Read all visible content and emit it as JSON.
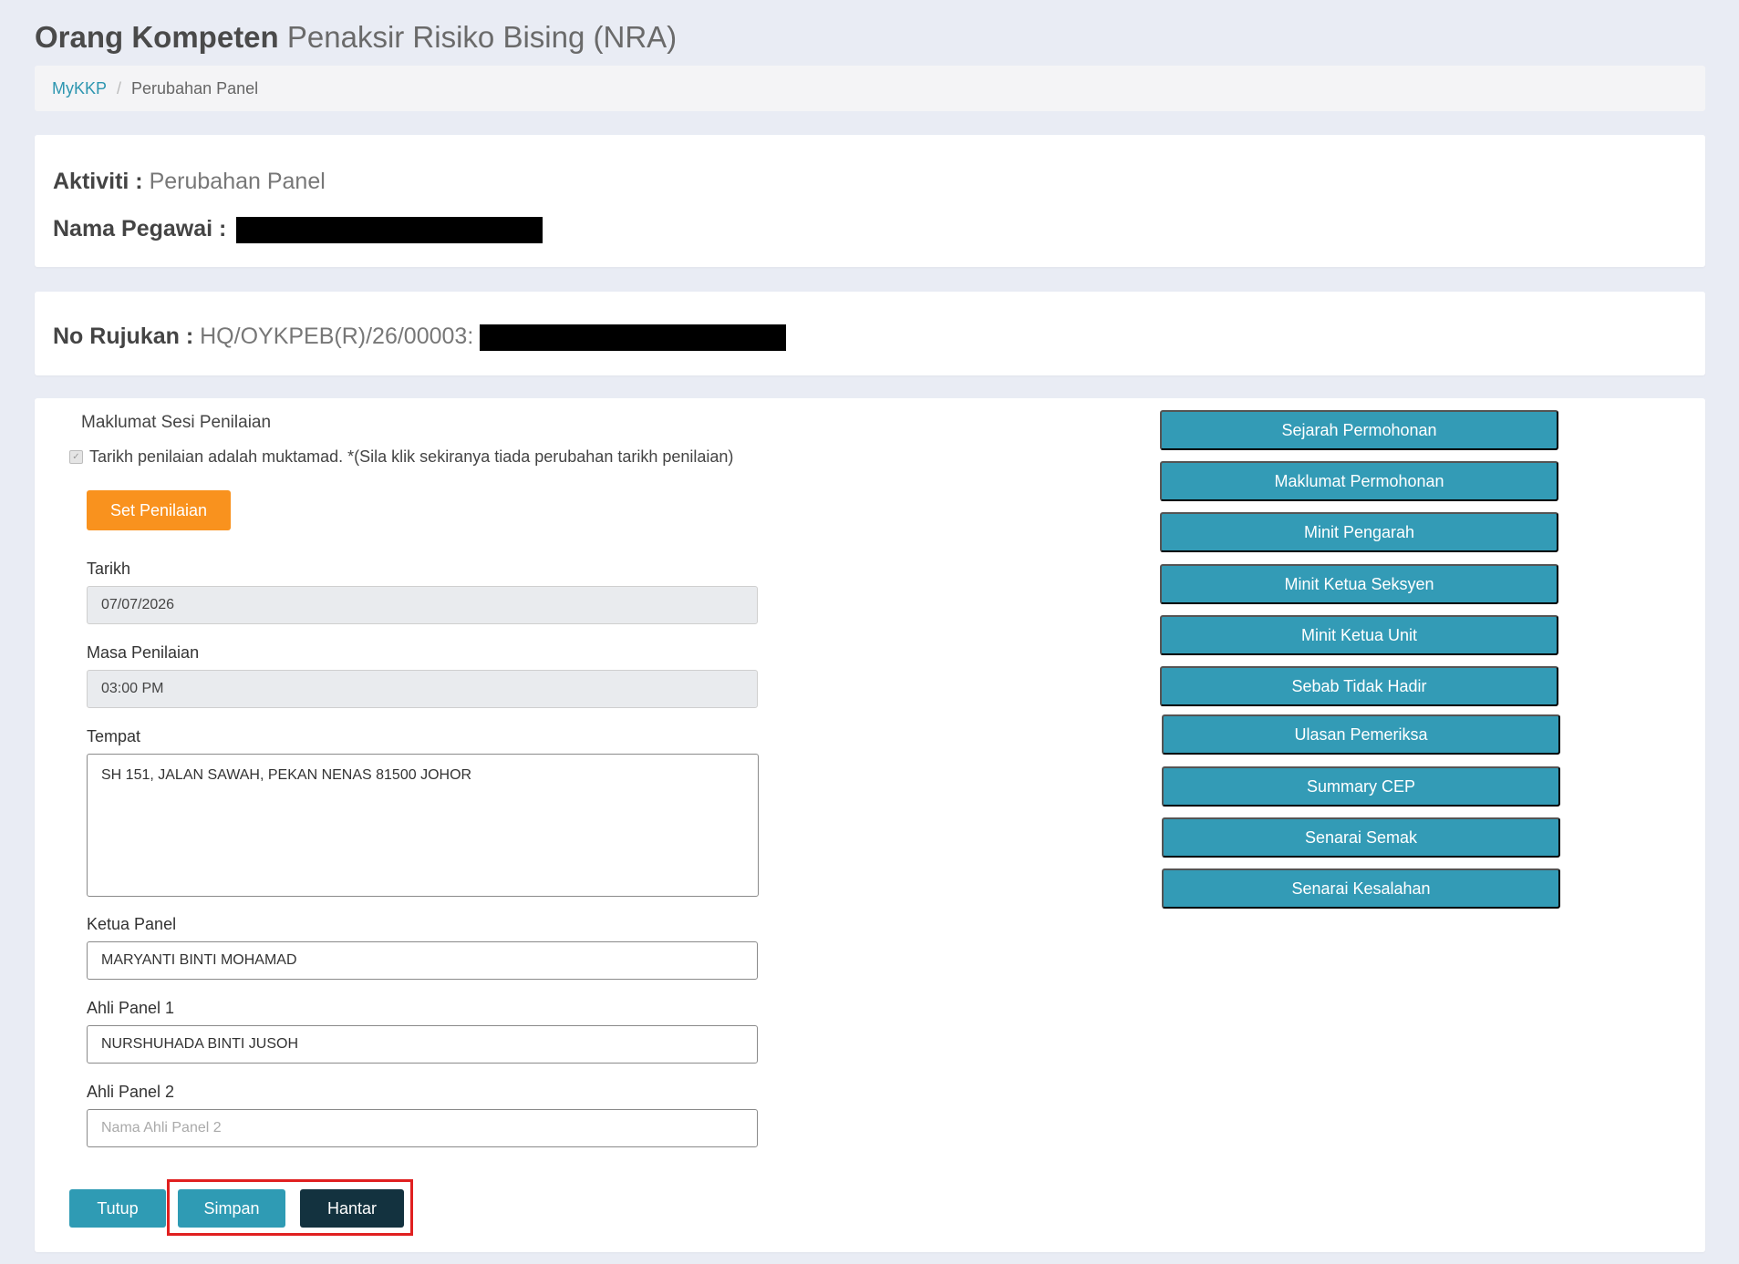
{
  "header": {
    "title_bold": "Orang Kompeten",
    "title_light": "Penaksir Risiko Bising (NRA)"
  },
  "breadcrumb": {
    "home": "MyKKP",
    "separator": "/",
    "current": "Perubahan Panel"
  },
  "activity": {
    "aktiviti_label": "Aktiviti :",
    "aktiviti_value": "Perubahan Panel",
    "pegawai_label": "Nama Pegawai :"
  },
  "reference": {
    "label": "No Rujukan :",
    "value": "HQ/OYKPEB(R)/26/00003:"
  },
  "form": {
    "section_title": "Maklumat Sesi Penilaian",
    "checkbox_label": "Tarikh penilaian adalah muktamad. *(Sila klik sekiranya tiada perubahan tarikh penilaian)",
    "checkbox_checked": true,
    "set_button": "Set Penilaian",
    "tarikh_label": "Tarikh",
    "tarikh_value": "07/07/2026",
    "masa_label": "Masa Penilaian",
    "masa_value": "03:00 PM",
    "tempat_label": "Tempat",
    "tempat_value": "SH 151, JALAN SAWAH, PEKAN NENAS 81500 JOHOR",
    "ketua_label": "Ketua Panel",
    "ketua_value": "MARYANTI BINTI MOHAMAD",
    "ahli1_label": "Ahli Panel 1",
    "ahli1_value": "NURSHUHADA BINTI JUSOH",
    "ahli2_label": "Ahli Panel 2",
    "ahli2_placeholder": "Nama Ahli Panel 2"
  },
  "side_buttons": [
    "Sejarah Permohonan",
    "Maklumat Permohonan",
    "Minit Pengarah",
    "Minit Ketua Seksyen",
    "Minit Ketua Unit",
    "Sebab Tidak Hadir",
    "Ulasan Pemeriksa",
    "Summary CEP",
    "Senarai Semak",
    "Senarai Kesalahan"
  ],
  "actions": {
    "tutup": "Tutup",
    "simpan": "Simpan",
    "hantar": "Hantar"
  },
  "colors": {
    "teal": "#339bb6",
    "orange": "#f9921e",
    "dark": "#13323f",
    "highlight": "#e02020"
  }
}
